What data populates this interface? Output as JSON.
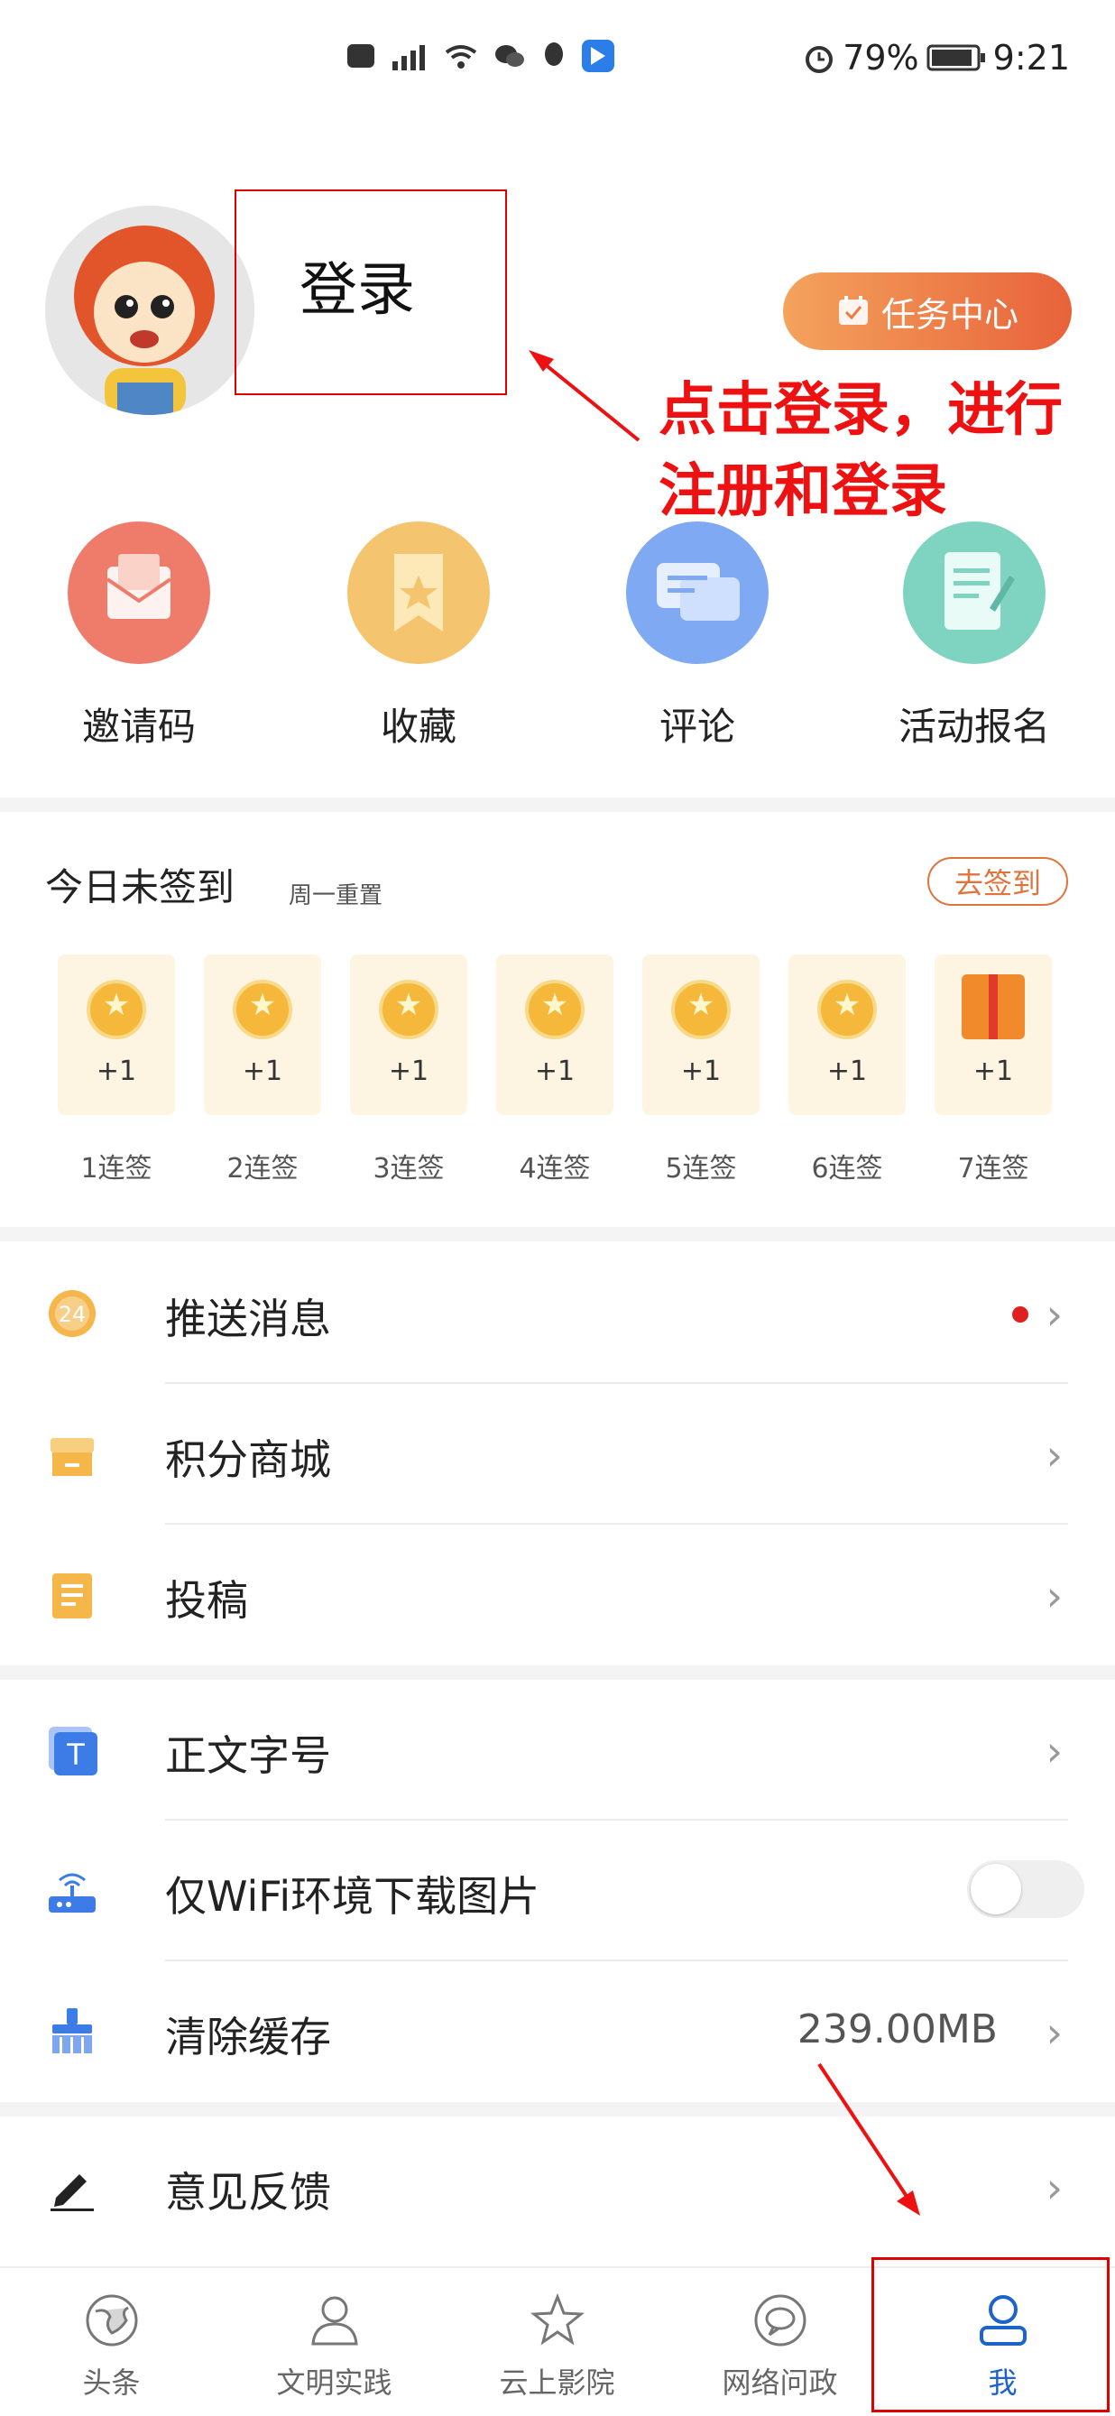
{
  "status_bar": {
    "left_icons": [
      "hd-icon",
      "4g-signal-icon",
      "wifi-icon",
      "wechat-icon",
      "qq-icon",
      "app-icon"
    ],
    "alarm_icon": "alarm-icon",
    "battery_percent": "79%",
    "time": "9:21"
  },
  "profile": {
    "login_label": "登录",
    "task_center_label": "任务中心",
    "annotation": "点击登录，进行注册和登录",
    "annotation_line1": "点击登录，进行",
    "annotation_line2": "注册和登录"
  },
  "quick_actions": [
    {
      "label": "邀请码",
      "icon": "invite-envelope-icon",
      "color": "#ef7b6b"
    },
    {
      "label": "收藏",
      "icon": "bookmark-icon",
      "color": "#f5c46e"
    },
    {
      "label": "评论",
      "icon": "comment-icon",
      "color": "#7fa9f2"
    },
    {
      "label": "活动报名",
      "icon": "signup-form-icon",
      "color": "#7fd4c1"
    }
  ],
  "signin": {
    "title": "今日未签到",
    "subtitle": "周一重置",
    "button_label": "去签到",
    "days": [
      {
        "reward": "+1",
        "label": "1连签"
      },
      {
        "reward": "+1",
        "label": "2连签"
      },
      {
        "reward": "+1",
        "label": "3连签"
      },
      {
        "reward": "+1",
        "label": "4连签"
      },
      {
        "reward": "+1",
        "label": "5连签"
      },
      {
        "reward": "+1",
        "label": "6连签"
      },
      {
        "reward": "+1",
        "label": "7连签"
      }
    ]
  },
  "menu_group1": [
    {
      "label": "推送消息",
      "icon": "clock-24-icon"
    },
    {
      "label": "积分商城",
      "icon": "shop-icon"
    },
    {
      "label": "投稿",
      "icon": "document-icon"
    }
  ],
  "menu_group2": [
    {
      "label": "正文字号",
      "icon": "font-size-icon"
    },
    {
      "label": "仅WiFi环境下载图片",
      "icon": "router-icon",
      "toggle_on": false
    },
    {
      "label": "清除缓存",
      "icon": "broom-icon",
      "value": "239.00MB"
    }
  ],
  "menu_group3": [
    {
      "label": "意见反馈",
      "icon": "pen-icon"
    }
  ],
  "bottom_nav": [
    {
      "label": "头条",
      "icon": "globe-icon"
    },
    {
      "label": "文明实践",
      "icon": "person-icon"
    },
    {
      "label": "云上影院",
      "icon": "star-icon"
    },
    {
      "label": "网络问政",
      "icon": "chat-bubble-icon"
    },
    {
      "label": "我",
      "icon": "profile-icon",
      "active": true
    }
  ],
  "colors": {
    "accent_blue": "#1e63c8",
    "annotation_red": "#ee1111",
    "task_gradient_start": "#f4a35d",
    "task_gradient_end": "#e8623a",
    "signin_orange": "#e0743d"
  }
}
